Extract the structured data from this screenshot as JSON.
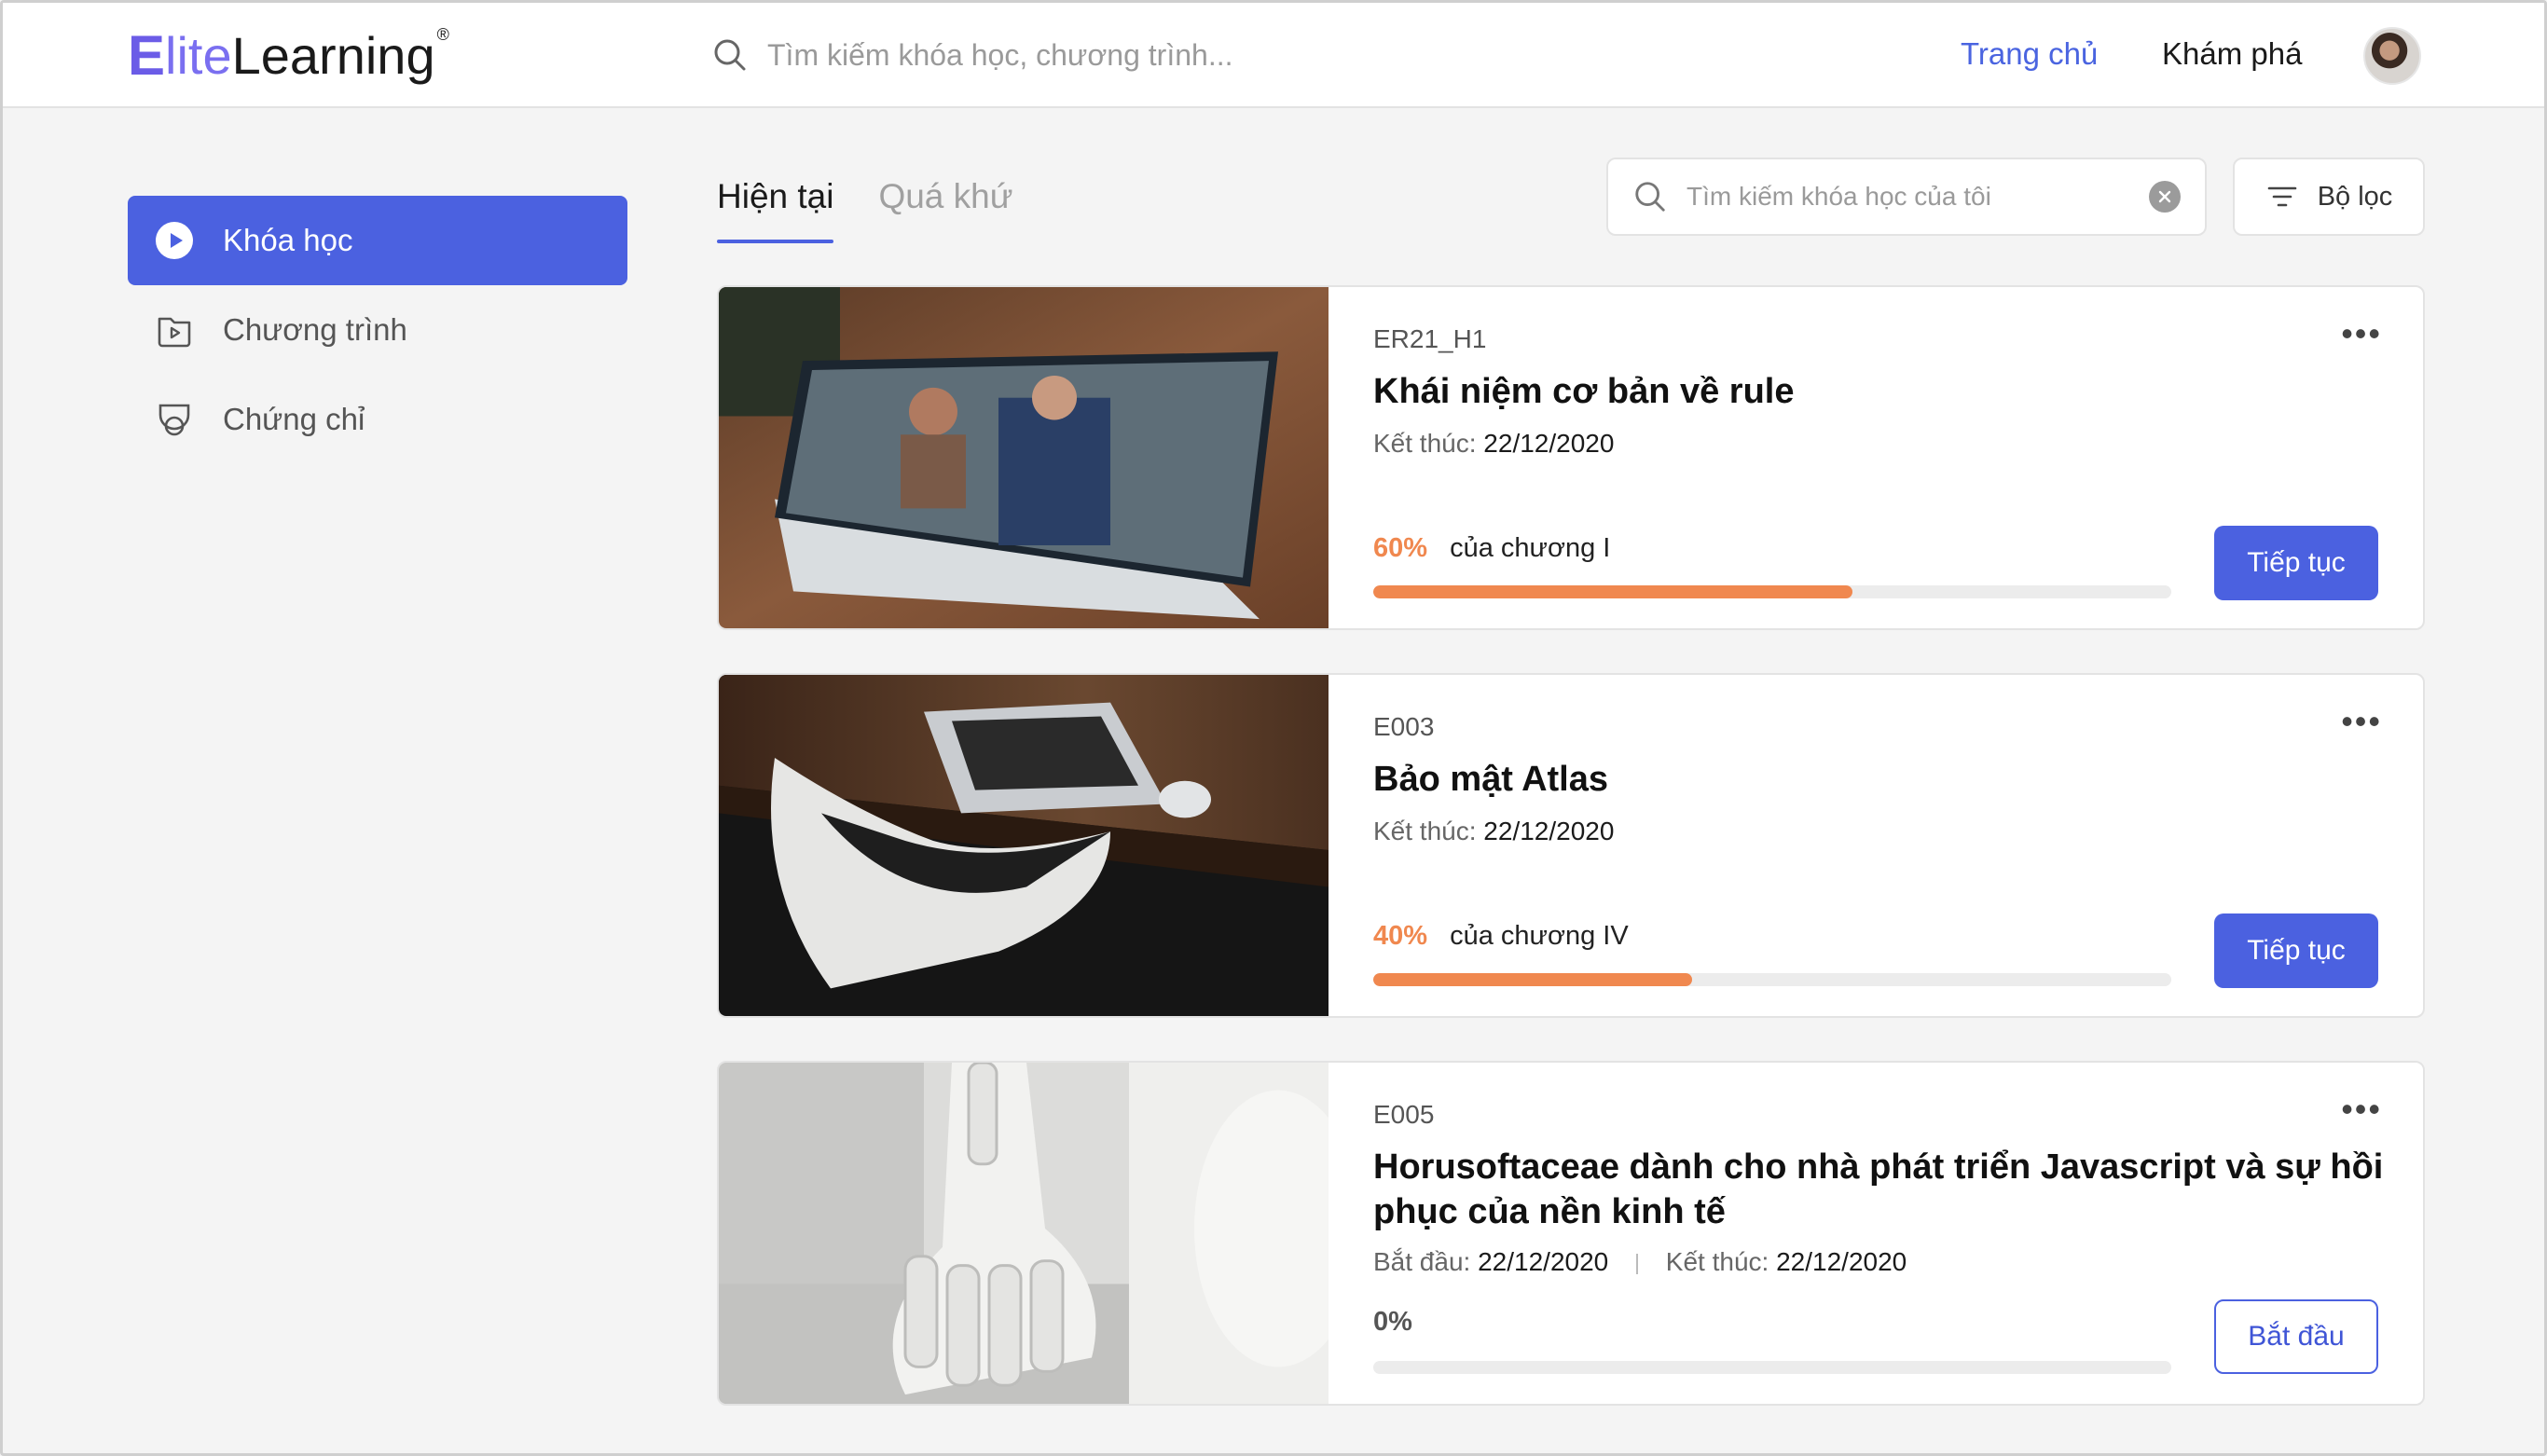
{
  "header": {
    "logo": {
      "e": "E",
      "lite": "lite",
      "learning": "Learning",
      "reg": "®"
    },
    "search_placeholder": "Tìm kiếm khóa học, chương trình...",
    "nav": {
      "home": "Trang chủ",
      "explore": "Khám phá"
    }
  },
  "sidebar": {
    "items": [
      {
        "label": "Khóa học",
        "icon": "play-circle-icon",
        "active": true
      },
      {
        "label": "Chương trình",
        "icon": "play-folder-icon",
        "active": false
      },
      {
        "label": "Chứng chỉ",
        "icon": "certificate-icon",
        "active": false
      }
    ]
  },
  "tabs": [
    {
      "label": "Hiện tại",
      "active": true
    },
    {
      "label": "Quá khứ",
      "active": false
    }
  ],
  "my_search": {
    "placeholder": "Tìm kiếm khóa học của tôi"
  },
  "filter": {
    "label": "Bộ lọc"
  },
  "colors": {
    "accent": "#4b61e0",
    "progress": "#f0884f"
  },
  "courses": [
    {
      "code": "ER21_H1",
      "title": "Khái niệm cơ bản về rule",
      "end_label": "Kết thúc:",
      "end_date": "22/12/2020",
      "progress_pct": "60%",
      "progress_value": 0.6,
      "progress_text": "của chương I",
      "action": "Tiếp tục"
    },
    {
      "code": "E003",
      "title": "Bảo mật Atlas",
      "end_label": "Kết thúc:",
      "end_date": "22/12/2020",
      "progress_pct": "40%",
      "progress_value": 0.4,
      "progress_text": "của chương IV",
      "action": "Tiếp tục"
    },
    {
      "code": "E005",
      "title": "Horusoftaceae dành cho nhà phát triển Javascript và sự hồi phục của nền kinh tế",
      "start_label": "Bắt đầu:",
      "start_date": "22/12/2020",
      "end_label": "Kết thúc:",
      "end_date": "22/12/2020",
      "progress_pct": "0%",
      "progress_value": 0,
      "action": "Bắt đầu"
    }
  ]
}
